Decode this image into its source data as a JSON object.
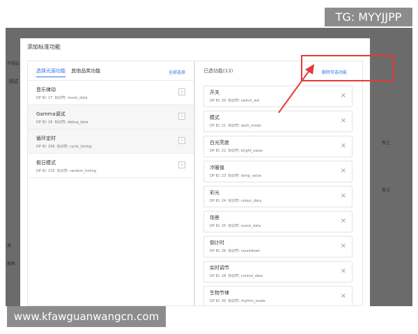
{
  "dialog": {
    "title": "添加标准功能",
    "left_panel": {
      "tabs": [
        {
          "label": "选择光源功能",
          "active": true
        },
        {
          "label": "其他品类功能",
          "active": false
        }
      ],
      "select_all": "全部选择",
      "items": [
        {
          "name": "音乐律动",
          "dp_label": "DP ID: 27",
          "id_label": "标识符: music_data",
          "add_icon": "chevron-right"
        },
        {
          "name": "Gamma调试",
          "dp_label": "DP ID: 29",
          "id_label": "标识符: debug_data",
          "add_icon": "chevron-right"
        },
        {
          "name": "循环定时",
          "dp_label": "DP ID: 209",
          "id_label": "标识符: cycle_timing",
          "add_icon": "chevron-right"
        },
        {
          "name": "假日模式",
          "dp_label": "DP ID: 210",
          "id_label": "标识符: random_timing",
          "add_icon": "chevron-right"
        }
      ]
    },
    "right_panel": {
      "header": "已选功能(13)",
      "remove_all": "删除可选功能",
      "items": [
        {
          "name": "开关",
          "dp_label": "DP ID: 20",
          "id_label": "标识符: switch_led"
        },
        {
          "name": "模式",
          "dp_label": "DP ID: 21",
          "id_label": "标识符: work_mode"
        },
        {
          "name": "白光亮度",
          "dp_label": "DP ID: 22",
          "id_label": "标识符: bright_value"
        },
        {
          "name": "冷暖值",
          "dp_label": "DP ID: 23",
          "id_label": "标识符: temp_value"
        },
        {
          "name": "彩光",
          "dp_label": "DP ID: 24",
          "id_label": "标识符: colour_data"
        },
        {
          "name": "场景",
          "dp_label": "DP ID: 25",
          "id_label": "标识符: scene_data"
        },
        {
          "name": "倒计时",
          "dp_label": "DP ID: 26",
          "id_label": "标识符: countdown"
        },
        {
          "name": "实时调节",
          "dp_label": "DP ID: 28",
          "id_label": "标识符: control_data"
        },
        {
          "name": "生物节律",
          "dp_label": "DP ID: 30",
          "id_label": "标识符: rhythm_mode"
        }
      ]
    }
  },
  "background": {
    "left_labels": [
      "评规云",
      "测试",
      "第",
      "期表"
    ],
    "right_labels": [
      "备注",
      "备注"
    ]
  },
  "remove_icon": "×",
  "watermarks": {
    "top": "TG: MYYJJPP",
    "bottom": "www.kfawguanwangcn.com"
  },
  "annotation": {
    "color": "#e53935"
  }
}
